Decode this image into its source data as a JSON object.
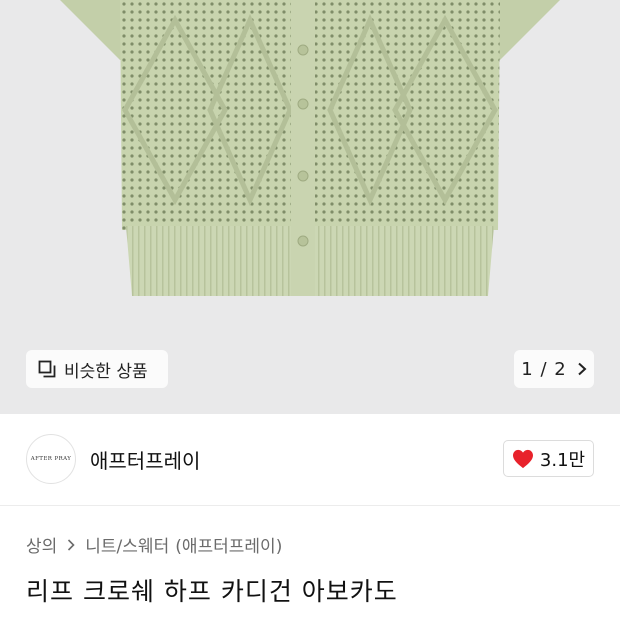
{
  "gallery": {
    "similar_label": "비슷한 상품",
    "similar_icon": "similar-items-icon",
    "pager_text": "1 / 2",
    "pager_icon": "chevron-right-icon",
    "product_color": "#c9d5b1"
  },
  "brand": {
    "logo_text": "AFTER PRAY",
    "name": "애프터프레이",
    "like_count": "3.1만",
    "like_icon": "heart-icon",
    "like_color": "#e8222b"
  },
  "breadcrumb": {
    "category": "상의",
    "subcategory": "니트/스웨터",
    "brand_suffix": "(애프터프레이)"
  },
  "product": {
    "title": "리프 크로쉐 하프 카디건 아보카도"
  }
}
